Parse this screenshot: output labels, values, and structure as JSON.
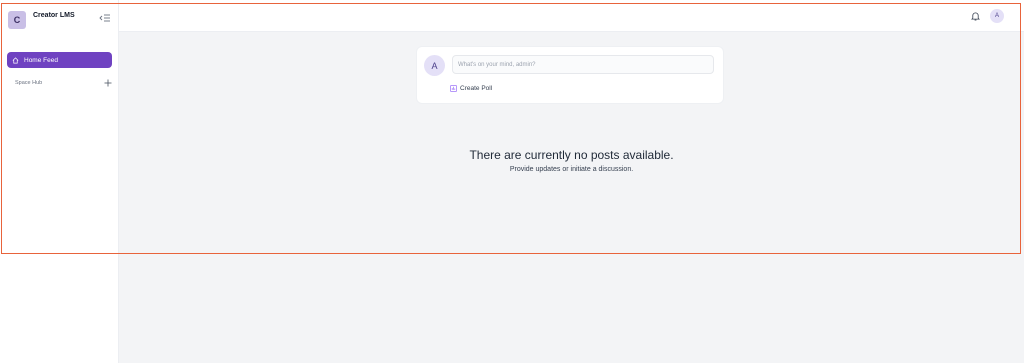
{
  "sidebar": {
    "brand_initial": "C",
    "brand_name": "Creator LMS",
    "nav_active_label": "Home Feed",
    "section_label": "Space Hub"
  },
  "topbar": {
    "avatar_initial": "A"
  },
  "composer": {
    "avatar_initial": "A",
    "placeholder": "What's on your mind, admin?",
    "create_poll_label": "Create Poll"
  },
  "empty_state": {
    "title": "There are currently no posts available.",
    "subtitle": "Provide updates or initiate a discussion."
  },
  "colors": {
    "accent": "#6f42c1",
    "main_bg": "#f3f4f6",
    "highlight_border": "#e8633b"
  }
}
